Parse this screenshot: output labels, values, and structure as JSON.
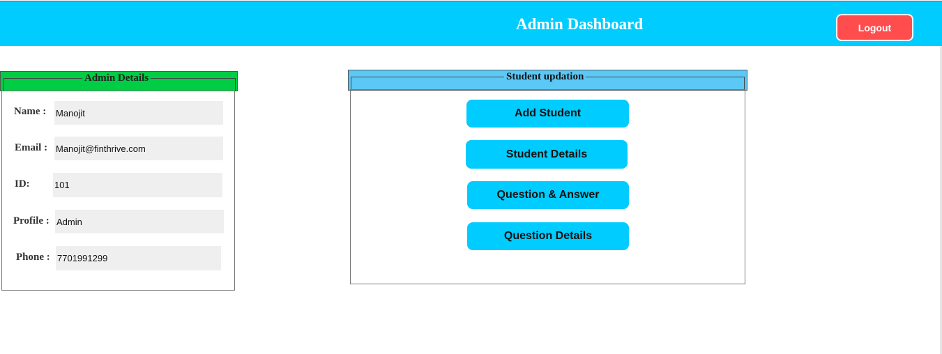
{
  "header": {
    "title": "Admin Dashboard",
    "logout_label": "Logout"
  },
  "admin_details": {
    "legend": "Admin Details",
    "fields": [
      {
        "label": "Name :",
        "value": "Manojit"
      },
      {
        "label": "Email :",
        "value": "Manojit@finthrive.com"
      },
      {
        "label": "ID:",
        "value": "101"
      },
      {
        "label": "Profile :",
        "value": "Admin"
      },
      {
        "label": "Phone :",
        "value": "7701991299"
      }
    ]
  },
  "student_updation": {
    "legend": "Student updation",
    "buttons": [
      {
        "label": "Add Student"
      },
      {
        "label": "Student Details"
      },
      {
        "label": "Question & Answer"
      },
      {
        "label": "Question Details"
      }
    ]
  },
  "colors": {
    "header_bg": "#00ccff",
    "logout_bg": "#ff4d4d",
    "admin_legend_bg": "#00cc44",
    "student_legend_bg": "#5bc8f5",
    "action_button_bg": "#00ccff",
    "input_bg": "#efefef"
  }
}
